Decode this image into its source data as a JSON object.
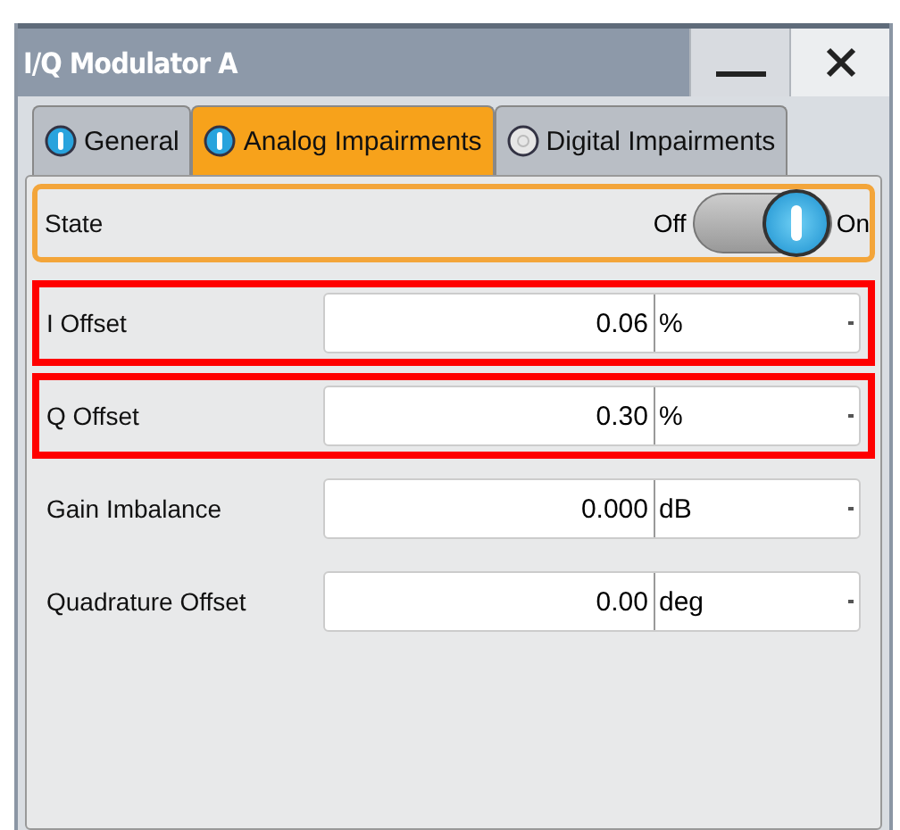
{
  "window": {
    "title": "I/Q Modulator A"
  },
  "tabs": [
    {
      "label": "General",
      "selected": false,
      "on": true
    },
    {
      "label": "Analog Impairments",
      "selected": true,
      "on": true
    },
    {
      "label": "Digital Impairments",
      "selected": false,
      "on": false
    }
  ],
  "state": {
    "label": "State",
    "off_label": "Off",
    "on_label": "On",
    "on": true
  },
  "rows": [
    {
      "label": "I Offset",
      "value": "0.06",
      "unit": "%",
      "highlighted": true
    },
    {
      "label": "Q Offset",
      "value": "0.30",
      "unit": "%",
      "highlighted": true
    },
    {
      "label": "Gain Imbalance",
      "value": "0.000",
      "unit": "dB",
      "highlighted": false
    },
    {
      "label": "Quadrature Offset",
      "value": "0.00",
      "unit": "deg",
      "highlighted": false
    }
  ]
}
